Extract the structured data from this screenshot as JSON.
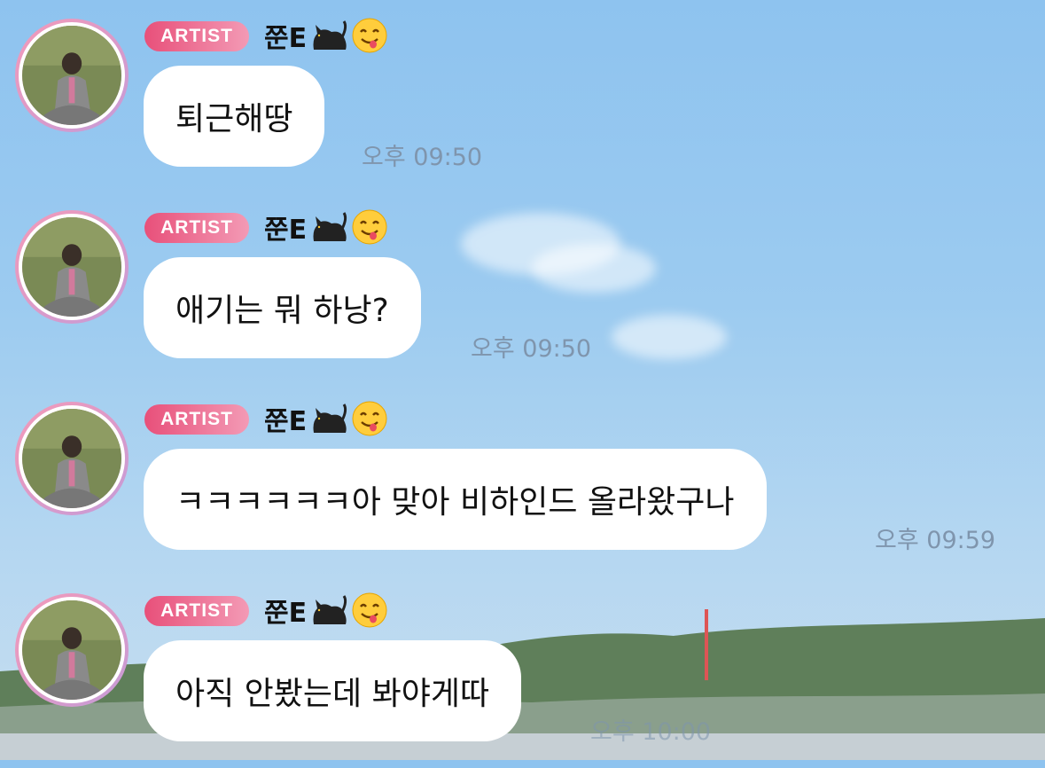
{
  "chat": {
    "messages": [
      {
        "badge": "ARTIST",
        "name": "쭌E",
        "name_icons": [
          "cat-icon",
          "yum-face-icon"
        ],
        "text": "퇴근해땅",
        "time": "오후 09:50"
      },
      {
        "badge": "ARTIST",
        "name": "쭌E",
        "name_icons": [
          "cat-icon",
          "yum-face-icon"
        ],
        "text": "애기는 뭐 하낭?",
        "time": "오후 09:50"
      },
      {
        "badge": "ARTIST",
        "name": "쭌E",
        "name_icons": [
          "cat-icon",
          "yum-face-icon"
        ],
        "text": "ㅋㅋㅋㅋㅋㅋ아 맞아 비하인드 올라왔구나",
        "time": "오후 09:59"
      },
      {
        "badge": "ARTIST",
        "name": "쭌E",
        "name_icons": [
          "cat-icon",
          "yum-face-icon"
        ],
        "text": "아직 안봤는데 봐야게따",
        "time": "오후 10:00"
      }
    ]
  },
  "theme": {
    "badge_gradient": [
      "#e8507a",
      "#f39ab5"
    ],
    "bubble_color": "#ffffff",
    "time_color": "#7f95ad",
    "sky_color": "#8ec3ef"
  }
}
